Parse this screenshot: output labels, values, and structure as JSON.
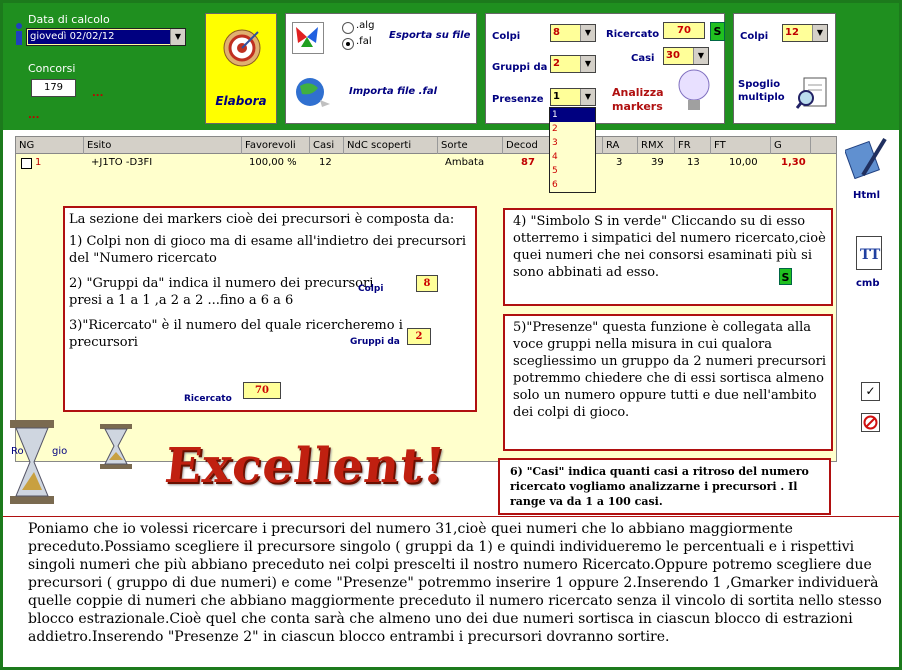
{
  "top": {
    "data_label": "Data di calcolo",
    "date_value": "giovedì 02/02/12",
    "concorsi_label": "Concorsi",
    "concorsi_value": "179",
    "dots1": "...",
    "dots2": "...",
    "elabora": "Elabora",
    "alg": ".alg",
    "fal": ".fal",
    "esporta": "Esporta su file",
    "importa": "Importa file .fal",
    "colpi_label": "Colpi",
    "colpi_value": "8",
    "gruppi_label": "Gruppi da",
    "gruppi_value": "2",
    "presenze_label": "Presenze",
    "presenze_value": "1",
    "presenze_options": [
      "1",
      "2",
      "3",
      "4",
      "5",
      "6"
    ],
    "ricercato_label": "Ricercato",
    "ricercato_value": "70",
    "s_badge": "S",
    "casi_label": "Casi",
    "casi_value": "30",
    "analizza": "Analizza markers",
    "colpi2_label": "Colpi",
    "colpi2_value": "12",
    "spoglio": "Spoglio multiplo"
  },
  "side": {
    "html": "Html",
    "cmb": "cmb",
    "check": "✓"
  },
  "grid": {
    "headers": [
      "NG",
      "Esito",
      "Favorevoli",
      "Casi",
      "NdC scoperti",
      "Sorte",
      "Decod",
      "RA",
      "RMX",
      "FR",
      "FT",
      "G"
    ],
    "row": [
      "1",
      "+J1TO -D3FI",
      "100,00 %",
      "12",
      "",
      "Ambata",
      "87",
      "3",
      "39",
      "13",
      "10,00",
      "1,30"
    ]
  },
  "ro_label": "Ro",
  "gio_label": "gio",
  "excellent": "Excellent!",
  "box1": {
    "intro": "La sezione dei markers cioè dei precursori è composta da:",
    "p1": "1) Colpi non di gioco ma di esame all'indietro dei precursori del \"Numero ricercato",
    "p1_lbl": "Colpi",
    "p1_val": "8",
    "p2": "2) \"Gruppi da\" indica il numero dei precursori presi a 1 a 1 ,a 2 a 2 ...fino a 6 a 6",
    "p2_lbl": "Gruppi da",
    "p2_val": "2",
    "p3": "3)\"Ricercato\" è il numero del quale ricercheremo i precursori",
    "p3_lbl": "Ricercato",
    "p3_val": "70"
  },
  "box2": {
    "text": "4) \"Simbolo S in verde\" Cliccando su di esso otterremo i simpatici del numero ricercato,cioè quei numeri che nei consorsi esaminati più si sono abbinati ad esso.",
    "badge": "S"
  },
  "box3": {
    "text": "5)\"Presenze\" questa funzione è collegata alla voce gruppi nella misura in cui qualora scegliessimo un gruppo da 2 numeri precursori potremmo chiedere che di essi sortisca almeno solo un numero oppure tutti e due nell'ambito dei colpi di gioco."
  },
  "box4": {
    "text": "6) \"Casi\" indica quanti casi a ritroso del numero ricercato vogliamo analizzarne i precursori . Il range va da 1 a 100 casi."
  },
  "bottom": {
    "text": "Poniamo che io volessi ricercare i precursori del numero 31,cioè quei numeri che lo abbiano maggiormente preceduto.Possiamo scegliere il precursore singolo ( gruppi da 1) e quindi individueremo le percentuali e i rispettivi singoli numeri che più abbiano preceduto nei colpi prescelti il nostro numero Ricercato.Oppure potremo scegliere due precursori ( gruppo di due numeri) e come \"Presenze\" potremmo inserire 1 oppure 2.Inserendo 1 ,Gmarker individuerà quelle coppie di numeri che abbiano maggiormente preceduto il numero ricercato senza il vincolo di sortita nello stesso blocco estrazionale.Cioè quel che conta sarà che almeno uno dei due numeri sortisca in ciascun blocco di estrazioni addietro.Inserendo \"Presenze 2\" in ciascun blocco entrambi i precursori dovranno sortire."
  }
}
